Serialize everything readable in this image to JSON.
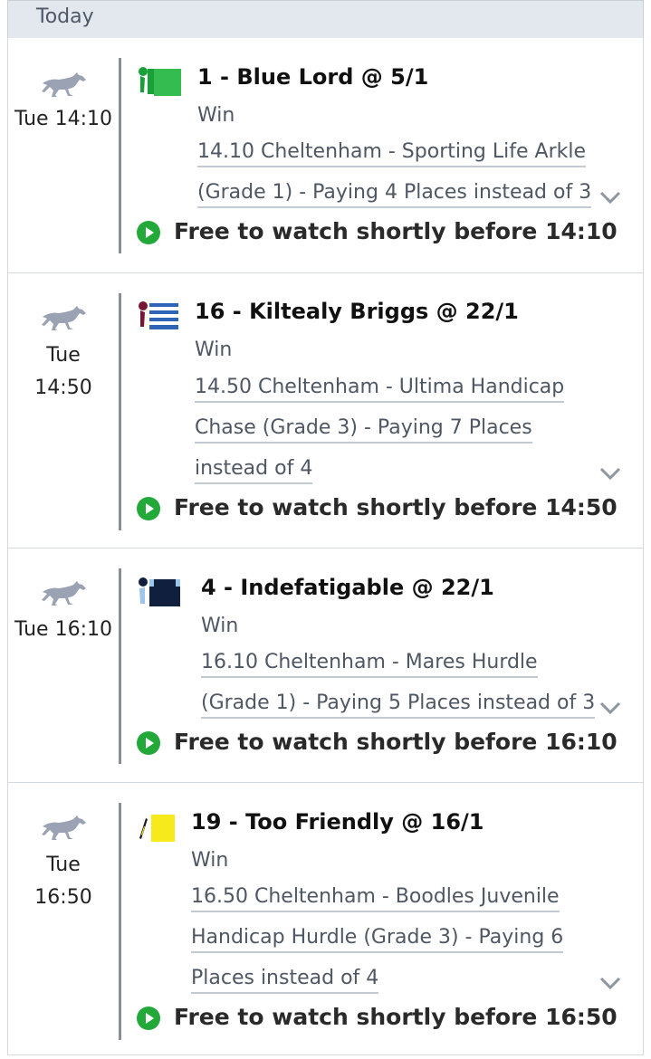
{
  "header": {
    "label": "Today"
  },
  "bets": [
    {
      "time": "Tue 14:10",
      "selection": "1 - Blue Lord @ 5/1",
      "bet_type": "Win",
      "race_lines": [
        "14.10 Cheltenham - Sporting Life Arkle",
        "(Grade 1) - Paying 4 Places instead of 3"
      ],
      "watch": "Free to watch shortly before 14:10",
      "silk": "green"
    },
    {
      "time_line1": "Tue",
      "time_line2": "14:50",
      "selection": "16 - Kiltealy Briggs @ 22/1",
      "bet_type": "Win",
      "race_lines": [
        "14.50 Cheltenham - Ultima Handicap",
        "Chase (Grade 3) - Paying 7 Places",
        "instead of 4"
      ],
      "watch": "Free to watch shortly before 14:50",
      "silk": "maroon-blue-hoops"
    },
    {
      "time": "Tue 16:10",
      "selection": "4 - Indefatigable @ 22/1",
      "bet_type": "Win",
      "race_lines": [
        "16.10 Cheltenham - Mares Hurdle",
        "(Grade 1) - Paying 5 Places instead of 3"
      ],
      "watch": "Free to watch shortly before 16:10",
      "silk": "navy-light-blue"
    },
    {
      "time_line1": "Tue",
      "time_line2": "16:50",
      "selection": "19 - Too Friendly @ 16/1",
      "bet_type": "Win",
      "race_lines": [
        "16.50 Cheltenham - Boodles Juvenile",
        "Handicap Hurdle (Grade 3) - Paying 6",
        "Places instead of 4"
      ],
      "watch": "Free to watch shortly before 16:50",
      "silk": "yellow"
    }
  ],
  "colors": {
    "play": "#22a93a",
    "horse": "#9aa2b4",
    "divider": "#8a8f97"
  }
}
